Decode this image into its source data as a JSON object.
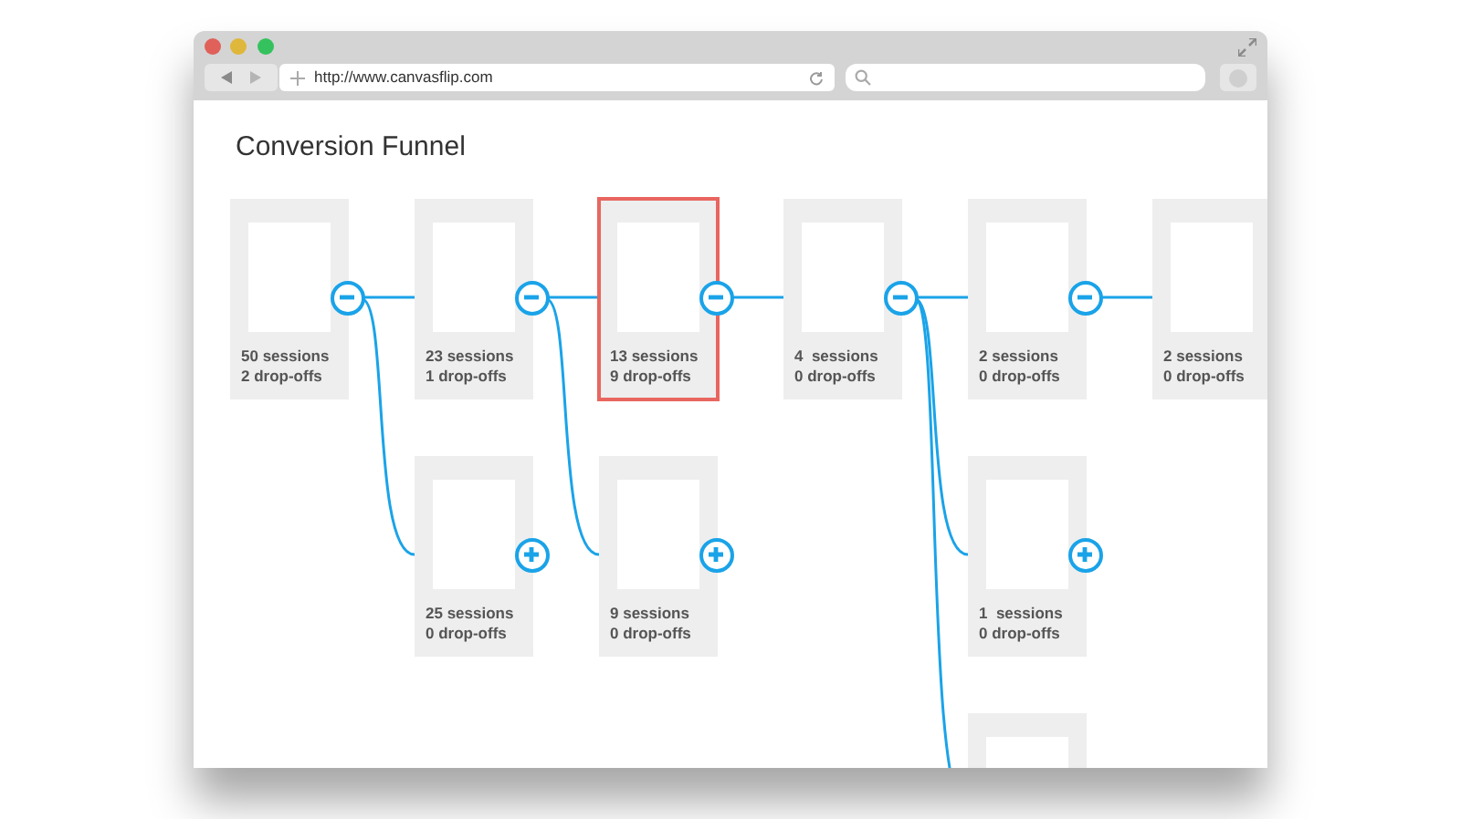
{
  "browser": {
    "url": "http://www.canvasflip.com"
  },
  "page": {
    "title": "Conversion Funnel"
  },
  "funnel": {
    "sessions": "50 sessions",
    "dropoffs": "2 drop-offs",
    "selected": false,
    "expanded": true,
    "children": [
      {
        "sessions": "23 sessions",
        "dropoffs": "1 drop-offs",
        "selected": false,
        "expanded": true,
        "children": [
          {
            "sessions": "13 sessions",
            "dropoffs": "9 drop-offs",
            "selected": true,
            "expanded": true,
            "children": [
              {
                "sessions": "4  sessions",
                "dropoffs": "0 drop-offs",
                "selected": false,
                "expanded": true,
                "children": [
                  {
                    "sessions": "2 sessions",
                    "dropoffs": "0 drop-offs",
                    "selected": false,
                    "expanded": true,
                    "children": [
                      {
                        "sessions": "2 sessions",
                        "dropoffs": "0 drop-offs",
                        "selected": false
                      }
                    ]
                  },
                  {
                    "sessions": "1  sessions",
                    "dropoffs": "0 drop-offs",
                    "selected": false,
                    "expanded": false
                  },
                  {
                    "selected": false
                  }
                ]
              }
            ]
          },
          {
            "sessions": "9 sessions",
            "dropoffs": "0 drop-offs",
            "selected": false,
            "expanded": false
          }
        ]
      },
      {
        "sessions": "25 sessions",
        "dropoffs": "0 drop-offs",
        "selected": false,
        "expanded": false
      }
    ]
  }
}
